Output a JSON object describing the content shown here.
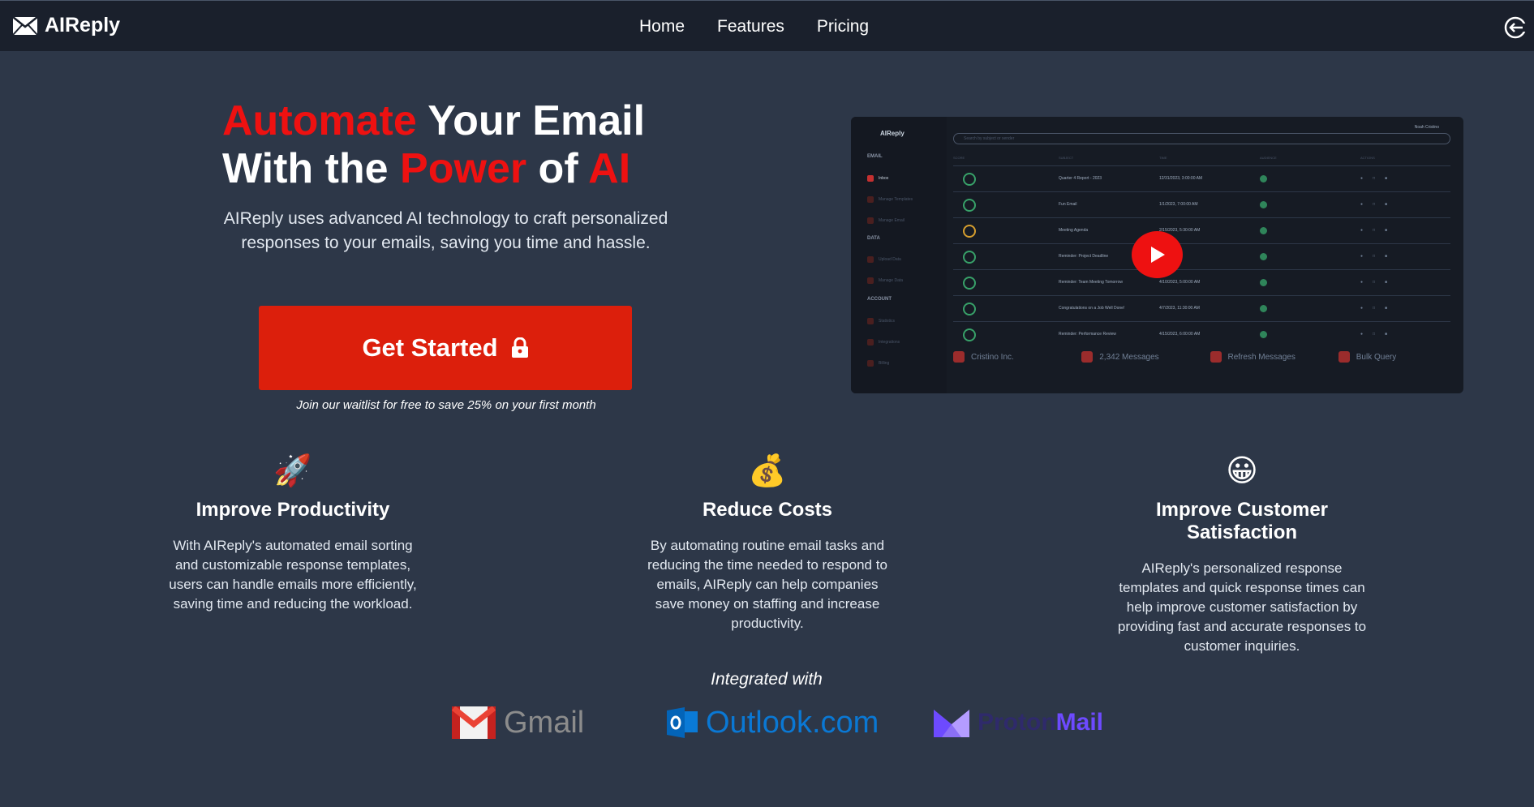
{
  "nav": {
    "brand": "AIReply",
    "links": [
      "Home",
      "Features",
      "Pricing"
    ]
  },
  "hero": {
    "title_parts": [
      "Automate",
      " Your Email",
      "With the ",
      "Power",
      " of ",
      "AI"
    ],
    "description": "AIReply uses advanced AI technology to craft personalized responses to your emails, saving you time and hassle.",
    "cta_label": "Get Started",
    "waitlist": "Join our waitlist for free to save 25% on your first month"
  },
  "video": {
    "brand": "AIReply",
    "user": "Noah Cristino",
    "search_placeholder": "Search by subject or sender",
    "sections": [
      "EMAIL",
      "DATA",
      "ACCOUNT"
    ],
    "email_items": [
      "Inbox",
      "Manage Templates",
      "Manage Email"
    ],
    "data_items": [
      "Upload Data",
      "Manage Data"
    ],
    "account_items": [
      "Statistics",
      "Integrations",
      "Billing"
    ],
    "columns": [
      "SCORE",
      "SUBJECT",
      "TIME",
      "AUDIENCE",
      "ACTIONS"
    ],
    "rows": [
      {
        "subject": "Quarter 4 Report - 2023",
        "time": "12/31/2023, 3:00:00 AM"
      },
      {
        "subject": "Fun Email",
        "time": "1/1/2023, 7:00:00 AM"
      },
      {
        "subject": "Meeting Agenda",
        "time": "2/15/2023, 5:30:00 AM"
      },
      {
        "subject": "Reminder: Project Deadline",
        "time": "12:00:00 PM"
      },
      {
        "subject": "Reminder: Team Meeting Tomorrow",
        "time": "4/10/2023, 5:00:00 AM"
      },
      {
        "subject": "Congratulations on a Job Well Done!",
        "time": "4/7/2023, 11:30:00 AM"
      },
      {
        "subject": "Reminder: Performance Review",
        "time": "4/15/2023, 6:00:00 AM"
      }
    ],
    "footer": [
      "Cristino Inc.",
      "2,342 Messages",
      "Refresh Messages",
      "Bulk Query"
    ]
  },
  "features": [
    {
      "emoji": "🚀",
      "title": "Improve Productivity",
      "text": "With AIReply's automated email sorting and customizable response templates, users can handle emails more efficiently, saving time and reducing the workload."
    },
    {
      "emoji": "💰",
      "title": "Reduce Costs",
      "text": "By automating routine email tasks and reducing the time needed to respond to emails, AIReply can help companies save money on staffing and increase productivity."
    },
    {
      "emoji": "😀",
      "title": "Improve Customer Satisfaction",
      "text": "AIReply's personalized response templates and quick response times can help improve customer satisfaction by providing fast and accurate responses to customer inquiries."
    }
  ],
  "integrations": {
    "label": "Integrated with",
    "gmail": "Gmail",
    "outlook": "Outlook.com",
    "proton": [
      "Proton",
      "Mail"
    ]
  },
  "colors": {
    "accent_red": "#ee1111",
    "cta_red": "#dc1f0c",
    "page_bg": "#2d3748",
    "nav_bg": "#1a202c"
  }
}
